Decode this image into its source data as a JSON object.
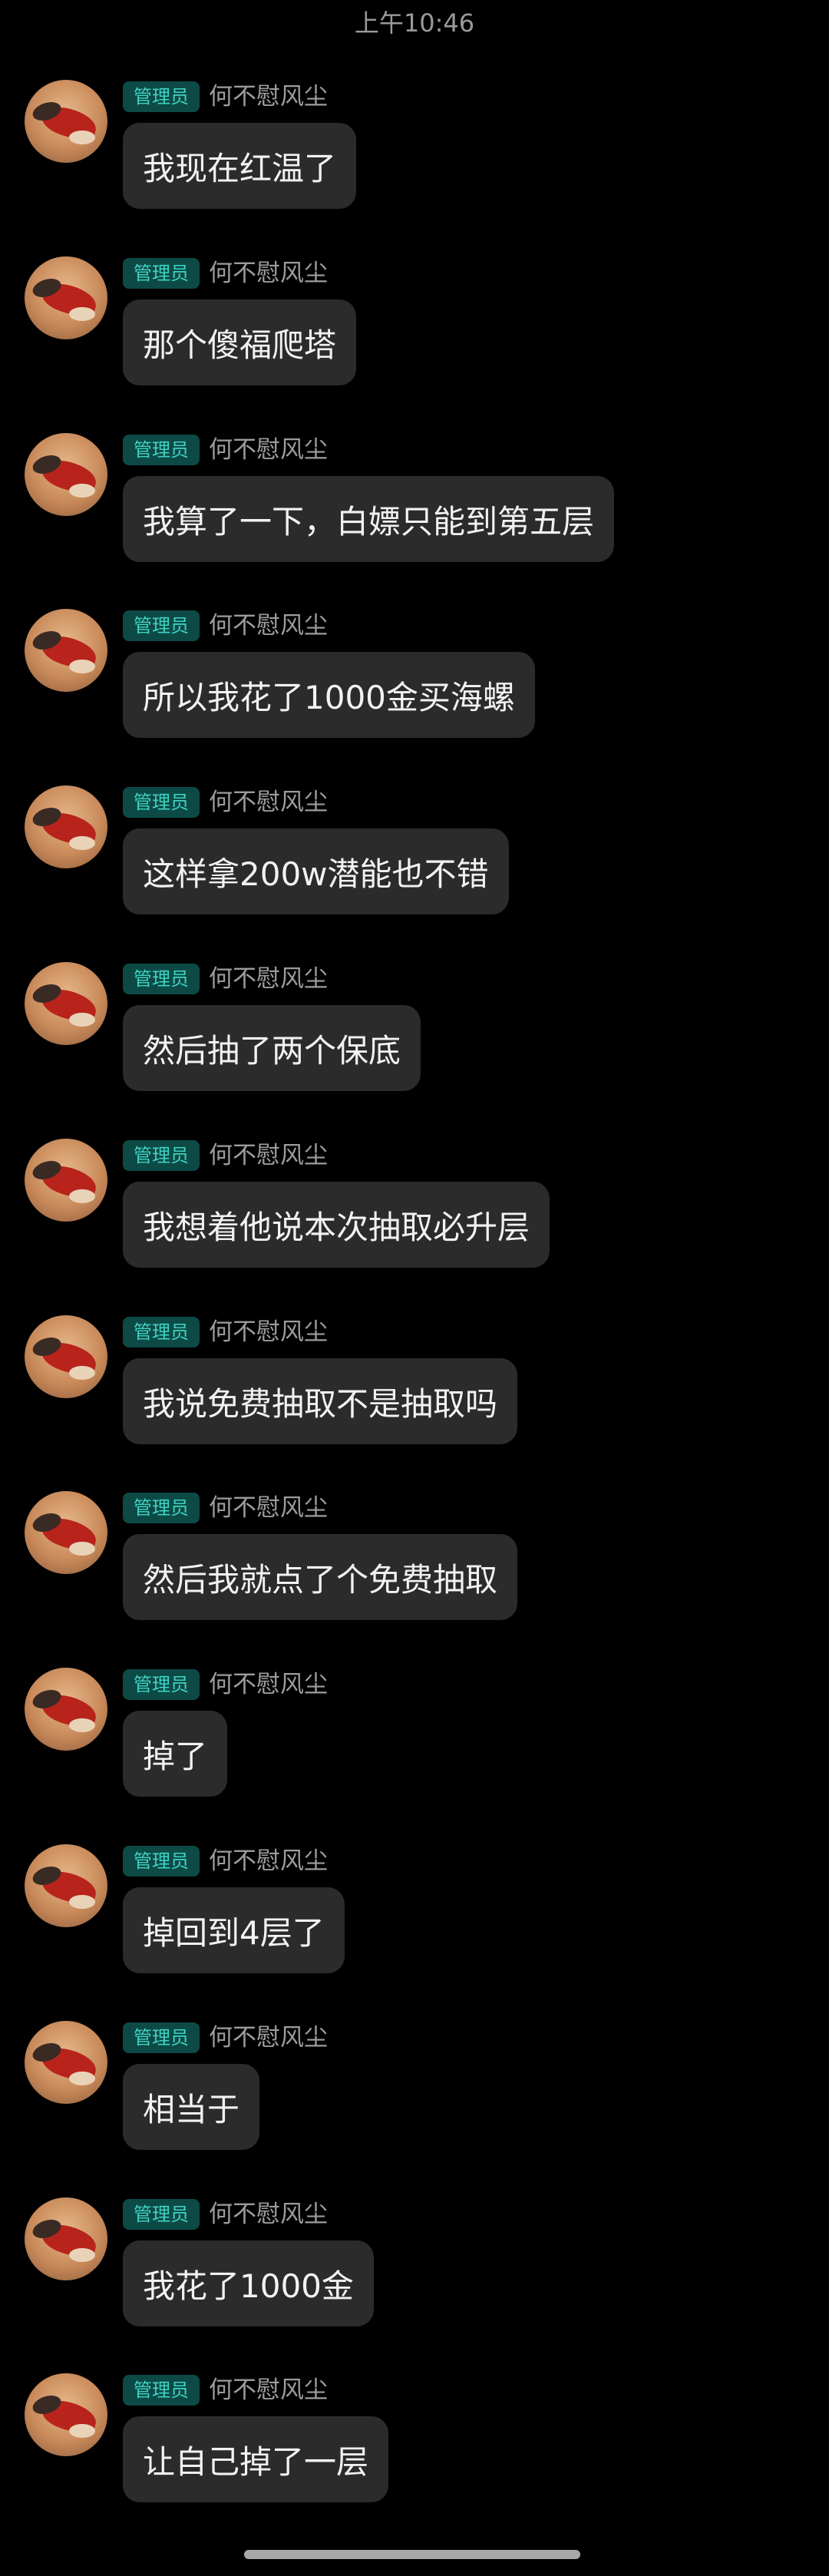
{
  "header": {
    "time": "上午10:46"
  },
  "messages": [
    {
      "badge": "管理员",
      "sender": "何不慰风尘",
      "text": "我现在红温了"
    },
    {
      "badge": "管理员",
      "sender": "何不慰风尘",
      "text": "那个傻福爬塔"
    },
    {
      "badge": "管理员",
      "sender": "何不慰风尘",
      "text": "我算了一下，白嫖只能到第五层"
    },
    {
      "badge": "管理员",
      "sender": "何不慰风尘",
      "text": "所以我花了1000金买海螺"
    },
    {
      "badge": "管理员",
      "sender": "何不慰风尘",
      "text": "这样拿200w潜能也不错"
    },
    {
      "badge": "管理员",
      "sender": "何不慰风尘",
      "text": "然后抽了两个保底"
    },
    {
      "badge": "管理员",
      "sender": "何不慰风尘",
      "text": "我想着他说本次抽取必升层"
    },
    {
      "badge": "管理员",
      "sender": "何不慰风尘",
      "text": "我说免费抽取不是抽取吗"
    },
    {
      "badge": "管理员",
      "sender": "何不慰风尘",
      "text": "然后我就点了个免费抽取"
    },
    {
      "badge": "管理员",
      "sender": "何不慰风尘",
      "text": "掉了"
    },
    {
      "badge": "管理员",
      "sender": "何不慰风尘",
      "text": "掉回到4层了"
    },
    {
      "badge": "管理员",
      "sender": "何不慰风尘",
      "text": "相当于"
    },
    {
      "badge": "管理员",
      "sender": "何不慰风尘",
      "text": "我花了1000金"
    },
    {
      "badge": "管理员",
      "sender": "何不慰风尘",
      "text": "让自己掉了一层"
    }
  ],
  "colors": {
    "background": "#000000",
    "bubble": "#2b2b2b",
    "badge_bg": "#0d4a46",
    "badge_text": "#3fd3c4",
    "sender_text": "#9c9c9c"
  }
}
